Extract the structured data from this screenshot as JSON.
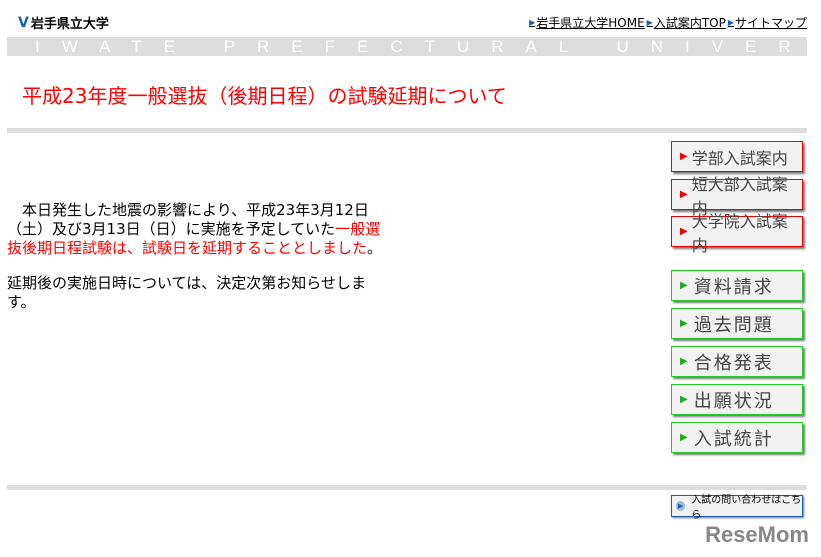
{
  "header": {
    "logo_text": "岩手県立大学",
    "links": [
      "岩手県立大学HOME",
      "入試案内TOP",
      "サイトマップ"
    ],
    "banner": "IWATE PREFECTURAL UNIVERSITY"
  },
  "title": "平成23年度一般選抜（後期日程）の試験延期について",
  "body": {
    "p1_a": "　本日発生した地震の影響により、平成23年3月12日（土）及び3月13日（日）に実施を予定していた",
    "p1_red": "一般選抜後期日程試験は、試験日を延期することとしました",
    "p1_end": "。",
    "p2": "延期後の実施日時については、決定次第お知らせします。"
  },
  "side": {
    "red": [
      "学部入試案内",
      "短大部入試案内",
      "大学院入試案内"
    ],
    "green": [
      "資料請求",
      "過去問題",
      "合格発表",
      "出願状況",
      "入試統計"
    ]
  },
  "inquiry": "入試の問い合わせはこちら",
  "watermark": "ReseMom",
  "colors": {
    "accent": "#ff0000",
    "green": "#22cc22",
    "blue": "#1a5fb4"
  }
}
